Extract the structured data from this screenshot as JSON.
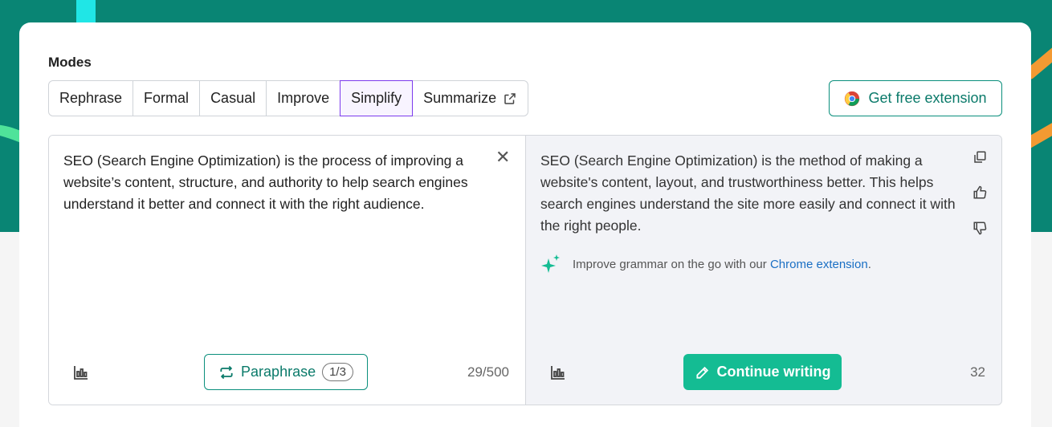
{
  "modes": {
    "label": "Modes",
    "items": [
      {
        "label": "Rephrase",
        "active": false
      },
      {
        "label": "Formal",
        "active": false
      },
      {
        "label": "Casual",
        "active": false
      },
      {
        "label": "Improve",
        "active": false
      },
      {
        "label": "Simplify",
        "active": true
      },
      {
        "label": "Summarize",
        "active": false
      }
    ]
  },
  "extension_button": {
    "label": "Get free extension",
    "icon": "chrome-logo-icon"
  },
  "input": {
    "text": "SEO (Search Engine Optimization) is the process of improving a website’s content, structure, and authority to help search engines understand it better and connect it with the right audience.",
    "count": "29/500"
  },
  "output": {
    "text": "SEO (Search Engine Optimization) is the method of making a website's content, layout, and trustworthiness better. This helps search engines understand the site more easily and connect it with the right people.",
    "tip_prefix": "Improve grammar on the go with our ",
    "tip_link": "Chrome extension",
    "tip_suffix": ".",
    "count": "32"
  },
  "paraphrase_button": {
    "label": "Paraphrase",
    "badge": "1/3"
  },
  "continue_button": {
    "label": "Continue writing"
  },
  "colors": {
    "brand_teal": "#098574",
    "accent_green": "#14bc93",
    "active_mode_border": "#7c3aed",
    "link_blue": "#1a6fc4"
  }
}
